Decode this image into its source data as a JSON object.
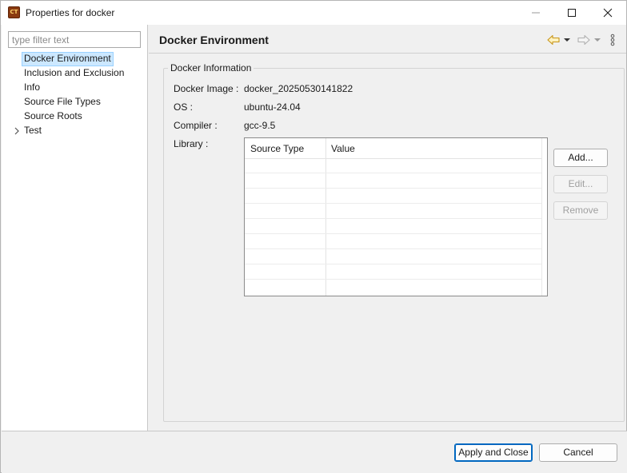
{
  "window": {
    "title": "Properties for docker",
    "icon_text": "CT"
  },
  "sidebar": {
    "filter_placeholder": "type filter text",
    "items": [
      {
        "label": "Docker Environment",
        "selected": true
      },
      {
        "label": "Inclusion and Exclusion",
        "selected": false
      },
      {
        "label": "Info",
        "selected": false
      },
      {
        "label": "Source File Types",
        "selected": false
      },
      {
        "label": "Source Roots",
        "selected": false
      },
      {
        "label": "Test",
        "selected": false,
        "expandable": true
      }
    ]
  },
  "page": {
    "title": "Docker Environment",
    "group_title": "Docker Information",
    "fields": {
      "image_label": "Docker Image :",
      "image_value": "docker_20250530141822",
      "os_label": "OS :",
      "os_value": "ubuntu-24.04",
      "compiler_label": "Compiler :",
      "compiler_value": "gcc-9.5",
      "library_label": "Library :"
    },
    "table": {
      "columns": [
        "Source Type",
        "Value"
      ],
      "rows": []
    },
    "buttons": {
      "add": "Add...",
      "edit": "Edit...",
      "remove": "Remove"
    }
  },
  "footer": {
    "apply_close": "Apply and Close",
    "cancel": "Cancel"
  },
  "colors": {
    "selection_bg": "#cce8ff",
    "selection_border": "#99d1ff",
    "default_button_border": "#0067c0",
    "nav_back_arrow": "#d4a017"
  },
  "icons": [
    "app-icon",
    "minimize-icon",
    "maximize-icon",
    "close-icon",
    "chevron-right-icon",
    "back-arrow-icon",
    "forward-arrow-icon",
    "dropdown-icon",
    "view-menu-icon"
  ]
}
